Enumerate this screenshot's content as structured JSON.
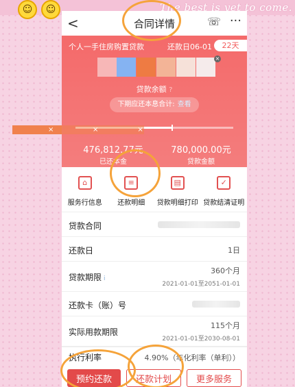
{
  "decor": {
    "motto": "The best is yet to come.",
    "emoji_face": "☺",
    "sticker_x": "×"
  },
  "header": {
    "back": "<",
    "title": "合同详情",
    "service_icon": "headset-icon",
    "service_glyph": "☏",
    "more": "···"
  },
  "card": {
    "title": "个人一手住房购置贷款",
    "due_label": "还款日06-01",
    "days_label": "22天",
    "swatch_colors": [
      "#f7b7b7",
      "#85b3f2",
      "#ee7b43",
      "#f3b497",
      "#f6e1d9",
      "#f5ebeb"
    ],
    "swatch_close": "×",
    "balance_label": "贷款余额",
    "balance_info": "?",
    "next_payment_label": "下期应还本息合计:",
    "next_payment_link": "查看",
    "progress_fraction": 0.61,
    "repaid_amount": "476,812.77元",
    "repaid_label": "已还本金",
    "loan_amount": "780,000.00元",
    "loan_label": "贷款金额"
  },
  "quick_actions": [
    {
      "label": "服务行信息",
      "icon": "bank-icon",
      "glyph": "⌂"
    },
    {
      "label": "还款明细",
      "icon": "statement-icon",
      "glyph": "≡"
    },
    {
      "label": "贷款明细打印",
      "icon": "printer-icon",
      "glyph": "▤"
    },
    {
      "label": "贷款结清证明",
      "icon": "certificate-icon",
      "glyph": "✓"
    }
  ],
  "details": {
    "contract_label": "贷款合同",
    "repay_day_label": "还款日",
    "repay_day_value": "1日",
    "term_label": "贷款期限",
    "term_info": "i",
    "term_value": "360个月",
    "term_range": "2021-01-01至2051-01-01",
    "card_label": "还款卡（账）号",
    "actual_term_label": "实际用款期限",
    "actual_term_value": "115个月",
    "actual_term_range": "2021-01-01至2030-08-01",
    "rate_label": "执行利率",
    "rate_value": "4.90%（年化利率（单利））"
  },
  "bottom": {
    "book_label": "预约还款",
    "plan_label": "还款计划",
    "more_label": "更多服务"
  },
  "colors": {
    "brand_red": "#e34a4a",
    "card_red": "#f46a6a",
    "annotation_orange": "#f5a33a",
    "sticker_orange": "#f0814d"
  }
}
